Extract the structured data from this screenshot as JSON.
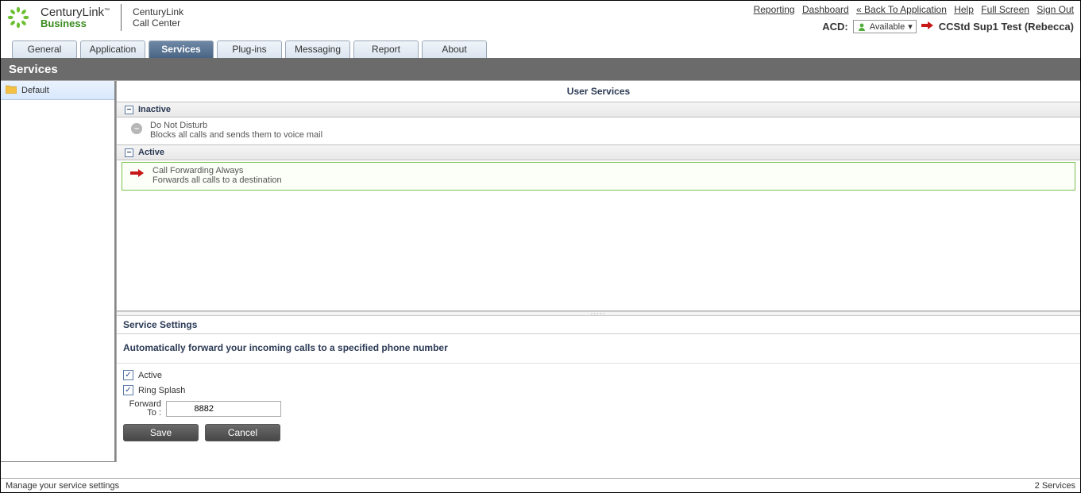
{
  "brand": {
    "company": "CenturyLink",
    "sub": "Business",
    "app_line1": "CenturyLink",
    "app_line2": "Call Center"
  },
  "top_links": {
    "reporting": "Reporting",
    "dashboard": "Dashboard",
    "back": "« Back To Application",
    "help": "Help",
    "full_screen": "Full Screen",
    "sign_out": "Sign Out"
  },
  "acd": {
    "label": "ACD:",
    "status": "Available",
    "user_name": "CCStd Sup1 Test (Rebecca)"
  },
  "tabs": {
    "general": "General",
    "application": "Application",
    "services": "Services",
    "plugins": "Plug-ins",
    "messaging": "Messaging",
    "report": "Report",
    "about": "About"
  },
  "page_title": "Services",
  "sidebar": {
    "default": "Default"
  },
  "content": {
    "title": "User Services",
    "sections": {
      "inactive": "Inactive",
      "active": "Active"
    },
    "services": {
      "dnd": {
        "title": "Do Not Disturb",
        "desc": "Blocks all calls and sends them to voice mail"
      },
      "cfa": {
        "title": "Call Forwarding Always",
        "desc": "Forwards all calls to a destination"
      }
    }
  },
  "settings": {
    "title": "Service Settings",
    "desc": "Automatically forward your incoming calls to a specified phone number",
    "active_label": "Active",
    "ring_splash_label": "Ring Splash",
    "forward_to_label": "Forward To :",
    "forward_to_value": "          8882",
    "save": "Save",
    "cancel": "Cancel"
  },
  "statusbar": {
    "left": "Manage your service settings",
    "right": "2 Services"
  }
}
